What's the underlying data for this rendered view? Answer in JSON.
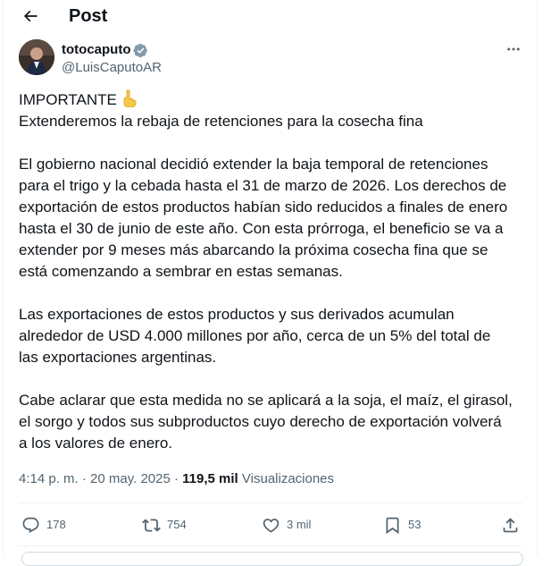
{
  "header": {
    "title": "Post"
  },
  "author": {
    "name": "totocaputo",
    "handle": "@LuisCaputoAR",
    "verified": true
  },
  "post": {
    "lines": [
      "IMPORTANTE",
      "Extenderemos la rebaja de retenciones para la cosecha fina",
      "El gobierno nacional decidió extender la baja temporal de retenciones",
      "para el trigo y la cebada hasta el 31 de marzo de 2026. Los derechos de",
      "exportación de estos productos habían sido reducidos a finales de enero",
      "hasta el 30 de junio de este año. Con esta prórroga, el beneficio se va a",
      "extender por 9 meses más abarcando la próxima cosecha fina que se",
      "está comenzando a sembrar en estas semanas.",
      "Las exportaciones de estos productos y sus derivados acumulan",
      "alrededor de USD 4.000 millones por año, cerca de un 5% del total de",
      "las exportaciones argentinas.",
      "Cabe aclarar que esta medida no se aplicará a la soja, el maíz, el girasol,",
      "el sorgo y todos sus subproductos cuyo derecho de exportación volverá",
      "a los valores de enero."
    ]
  },
  "meta": {
    "time": "4:14 p. m.",
    "separator": " · ",
    "date": "20 may. 2025",
    "views_count": "119,5 mil",
    "views_label": "Visualizaciones"
  },
  "actions": {
    "replies": "178",
    "reposts": "754",
    "likes": "3 mil",
    "bookmarks": "53"
  },
  "icons": {
    "back": "arrow-left-icon",
    "verified": "verified-badge-icon",
    "more": "more-horizontal-icon",
    "emoji": "backhand-index-pointing-down-emoji",
    "reply": "reply-icon",
    "repost": "repost-icon",
    "like": "heart-icon",
    "bookmark": "bookmark-icon",
    "share": "share-icon"
  },
  "colors": {
    "text": "#0f1419",
    "secondary": "#536471",
    "verified": "#829aab",
    "divider": "#eff3f4"
  }
}
